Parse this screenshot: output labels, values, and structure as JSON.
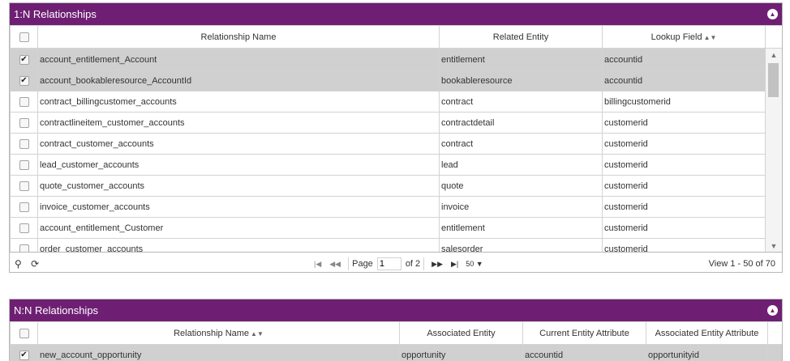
{
  "one_to_many": {
    "title": "1:N Relationships",
    "collapse_icon": "chevron-up-icon",
    "columns": {
      "name": "Relationship Name",
      "related_entity": "Related Entity",
      "lookup_field": "Lookup Field"
    },
    "rows": [
      {
        "name": "account_entitlement_Account",
        "related_entity": "entitlement",
        "lookup_field": "accountid",
        "selected": true
      },
      {
        "name": "account_bookableresource_AccountId",
        "related_entity": "bookableresource",
        "lookup_field": "accountid",
        "selected": true
      },
      {
        "name": "contract_billingcustomer_accounts",
        "related_entity": "contract",
        "lookup_field": "billingcustomerid",
        "selected": false
      },
      {
        "name": "contractlineitem_customer_accounts",
        "related_entity": "contractdetail",
        "lookup_field": "customerid",
        "selected": false
      },
      {
        "name": "contract_customer_accounts",
        "related_entity": "contract",
        "lookup_field": "customerid",
        "selected": false
      },
      {
        "name": "lead_customer_accounts",
        "related_entity": "lead",
        "lookup_field": "customerid",
        "selected": false
      },
      {
        "name": "quote_customer_accounts",
        "related_entity": "quote",
        "lookup_field": "customerid",
        "selected": false
      },
      {
        "name": "invoice_customer_accounts",
        "related_entity": "invoice",
        "lookup_field": "customerid",
        "selected": false
      },
      {
        "name": "account_entitlement_Customer",
        "related_entity": "entitlement",
        "lookup_field": "customerid",
        "selected": false
      },
      {
        "name": "order_customer_accounts",
        "related_entity": "salesorder",
        "lookup_field": "customerid",
        "selected": false
      }
    ],
    "pager": {
      "page_label": "Page",
      "page_value": "1",
      "of_label": "of 2",
      "page_size": "50",
      "view_text": "View 1 - 50 of 70"
    }
  },
  "many_to_many": {
    "title": "N:N Relationships",
    "collapse_icon": "chevron-up-icon",
    "columns": {
      "name": "Relationship Name",
      "associated_entity": "Associated Entity",
      "current_attr": "Current Entity Attribute",
      "associated_attr": "Associated Entity Attribute"
    },
    "rows": [
      {
        "name": "new_account_opportunity",
        "associated_entity": "opportunity",
        "current_attr": "accountid",
        "associated_attr": "opportunityid",
        "selected": true
      }
    ]
  },
  "colors": {
    "header_bg": "#6e1f73",
    "selected_row": "#d0d0d0",
    "border": "#d3d3d3"
  }
}
